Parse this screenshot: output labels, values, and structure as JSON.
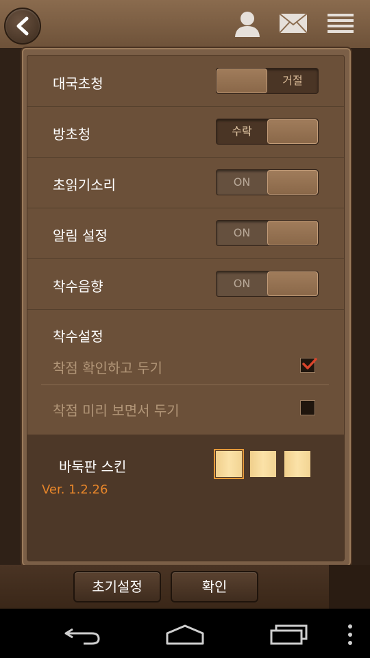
{
  "settings": [
    {
      "label": "대국초청",
      "toggle_text": "거절",
      "state": "off"
    },
    {
      "label": "방초청",
      "toggle_text": "수락",
      "state": "on"
    },
    {
      "label": "초읽기소리",
      "toggle_text": "ON",
      "state": "on"
    },
    {
      "label": "알림 설정",
      "toggle_text": "ON",
      "state": "on"
    },
    {
      "label": "착수음향",
      "toggle_text": "ON",
      "state": "on"
    }
  ],
  "placement": {
    "title": "착수설정",
    "options": [
      {
        "label": "착점 확인하고 두기",
        "checked": true
      },
      {
        "label": "착점 미리 보면서 두기",
        "checked": false
      }
    ]
  },
  "skin": {
    "label": "바둑판 스킨",
    "swatch_count": 3,
    "selected_index": 0
  },
  "version": "Ver. 1.2.26",
  "buttons": {
    "reset": "초기설정",
    "confirm": "확인"
  },
  "colors": {
    "accent_orange": "#e8862a",
    "check_red": "#d9442b"
  }
}
